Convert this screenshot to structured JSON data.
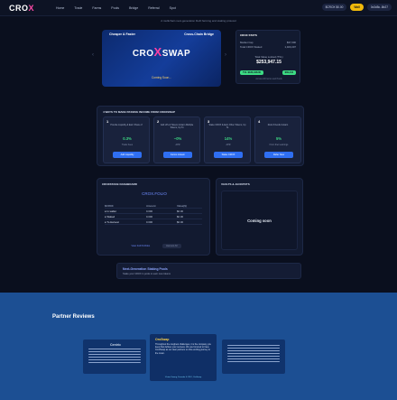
{
  "nav": {
    "logo_text": "CRO",
    "logo_x": "X",
    "links": [
      "Home",
      "Trade",
      "Farms",
      "Pools",
      "Bridge",
      "Referral",
      "Spot"
    ],
    "price": "$CROX $0.00",
    "wallet_label": "Wall",
    "address": "0x3d5c..8b27"
  },
  "tagline": "A multichain next-generation DeFi farming and staking protocol",
  "hero": {
    "left_label": "Cheaper & Faster",
    "right_label": "Cross-Chain Bridge",
    "logo_main": "CRO",
    "logo_x": "X",
    "logo_end": "SWAP",
    "subtitle": "Coming Soon..."
  },
  "stats": {
    "title": "CROX STATS",
    "rows": [
      {
        "label": "Market Cap",
        "value": "$37,000"
      },
      {
        "label": "Total CROX Staked",
        "value": "1,400,207"
      }
    ],
    "tvl_label": "Total Value Locked (TVL)",
    "tvl_value": "$253,947.15",
    "chip1": "TVL $183,348.00",
    "chip2": "$39,444",
    "footer": "Across All Farms and Pools"
  },
  "ways": {
    "title": "4 WAYS TO MAKE PASSIVE INCOME FROM CROXSWAP",
    "cards": [
      {
        "num": "1",
        "desc": "Provide Liquidity & Earn Share of",
        "value": "0.3%",
        "sub": "Trade Fees",
        "button": "Add Liquidity"
      },
      {
        "num": "2",
        "desc": "Add LPs & Tokens & Earn Multiple Tokens, Up To",
        "value": "~0%",
        "sub": "APR",
        "button": "Farms & Earn"
      },
      {
        "num": "3",
        "desc": "Stake CROX & Earn Other Tokens, Up To",
        "value": "14%",
        "sub": "APR",
        "button": "Stake CROX"
      },
      {
        "num": "4",
        "desc": "Refer Friends & Earn",
        "value": "5%",
        "sub": "From their earnings",
        "button": "Refer Now"
      }
    ]
  },
  "dashboard": {
    "title": "CROXSTAKE DASHBOARD",
    "brand": "CROX.FOLIO",
    "headers": [
      "$CROX",
      "Amount",
      "Value($)"
    ],
    "rows": [
      {
        "label": "In wallet",
        "amount": "0.000",
        "value": "$0.00"
      },
      {
        "label": "Staked",
        "amount": "0.000",
        "value": "$0.00"
      },
      {
        "label": "To Harvest",
        "amount": "0.000",
        "value": "$0.00"
      }
    ],
    "link_button": "View Full Portfolio",
    "dim_button": "Harvest All"
  },
  "vaults": {
    "title": "VAULTS & JACKPOTS",
    "coming_soon": "Coming soon"
  },
  "nextgen": {
    "title": "Next-Generation Staking Pools",
    "subtitle": "Stake your CROX in pools to earn new tokens"
  },
  "partners": {
    "title": "Partner Reviews",
    "left_logo": "Centric",
    "center_logo": "OroSwap",
    "center_text": "Throughout the toughest challenges, it is the company you keep that defines your success. We are honored to have CroxSwap as our dear partners on this exciting journey to the moon.",
    "center_foot": "Vivian Kwong, Founder & CEO, OroSwap"
  },
  "colors": {
    "background": "#0a0f1e",
    "accent_pink": "#ff3fa4",
    "accent_green": "#3ddc84",
    "button_blue": "#2f6ff2",
    "partners_bg": "#1c4f93"
  }
}
